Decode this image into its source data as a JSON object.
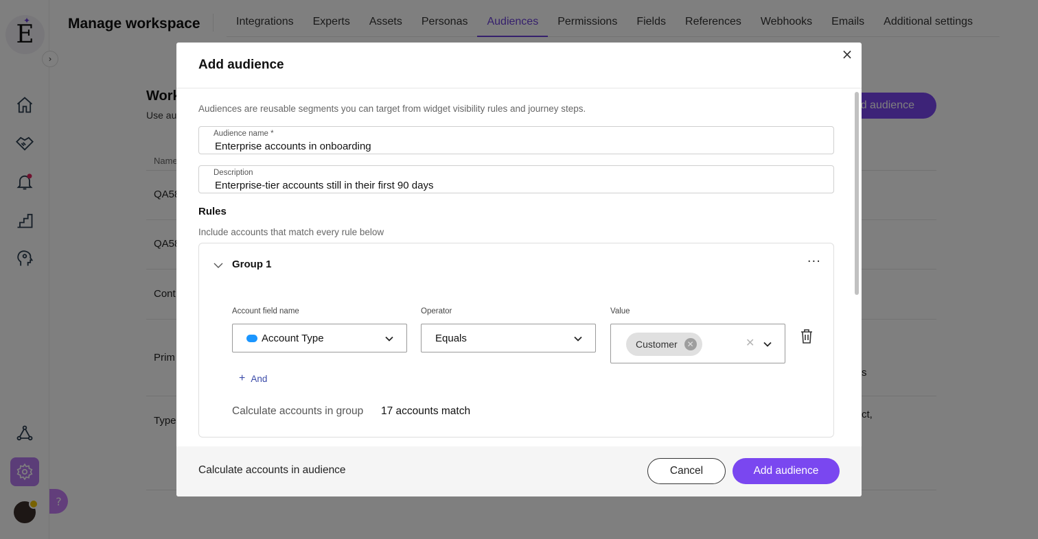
{
  "app": {
    "logo_letter": "E",
    "expand_symbol": "›",
    "help_symbol": "?",
    "page_title": "Manage workspace"
  },
  "tabs": [
    {
      "label": "Integrations",
      "active": false
    },
    {
      "label": "Experts",
      "active": false
    },
    {
      "label": "Assets",
      "active": false
    },
    {
      "label": "Personas",
      "active": false
    },
    {
      "label": "Audiences",
      "active": true
    },
    {
      "label": "Permissions",
      "active": false
    },
    {
      "label": "Fields",
      "active": false
    },
    {
      "label": "References",
      "active": false
    },
    {
      "label": "Webhooks",
      "active": false
    },
    {
      "label": "Emails",
      "active": false
    },
    {
      "label": "Additional settings",
      "active": false
    }
  ],
  "background": {
    "heading_partial": "Work",
    "subtitle_partial": "Use au",
    "add_button_partial": "d audience",
    "column_name_partial": "Name",
    "rows": [
      {
        "label": "QA58"
      },
      {
        "label": "QA58"
      },
      {
        "label": "Cont"
      },
      {
        "label": "Prim"
      },
      {
        "label": "Type"
      }
    ],
    "right_fragments": [
      "s",
      "ct,"
    ]
  },
  "modal": {
    "title": "Add audience",
    "close_symbol": "×",
    "intro": "Audiences are reusable segments you can target from widget visibility rules and journey steps.",
    "name_field": {
      "label": "Audience name *",
      "value": "Enterprise accounts in onboarding"
    },
    "description_field": {
      "label": "Description",
      "value": "Enterprise-tier accounts still in their first 90 days"
    },
    "rules_title": "Rules",
    "rules_subtitle": "Include accounts that match every rule below",
    "group": {
      "title": "Group 1",
      "more_symbol": "···",
      "field_label": "Account field name",
      "field_value": "Account Type",
      "operator_label": "Operator",
      "operator_value": "Equals",
      "value_label": "Value",
      "value_chip": "Customer",
      "chip_remove_symbol": "✕",
      "value_clear_symbol": "✕",
      "and_label": "And",
      "and_symbol": "+",
      "calc_label": "Calculate accounts in group",
      "calc_result": "17 accounts match"
    },
    "footer": {
      "calc_label": "Calculate accounts in audience",
      "cancel_label": "Cancel",
      "add_label": "Add audience"
    }
  },
  "colors": {
    "accent": "#7a47f0",
    "active_tab": "#6b3fd8",
    "link": "#3a4aa8",
    "salesforce": "#1b96ff"
  },
  "icons": [
    "home-icon",
    "handshake-icon",
    "bell-icon",
    "stairs-icon",
    "head-icon",
    "triangle-nodes-icon",
    "gear-icon",
    "trash-icon",
    "chevron-down-icon",
    "close-icon",
    "more-icon",
    "salesforce-icon"
  ]
}
